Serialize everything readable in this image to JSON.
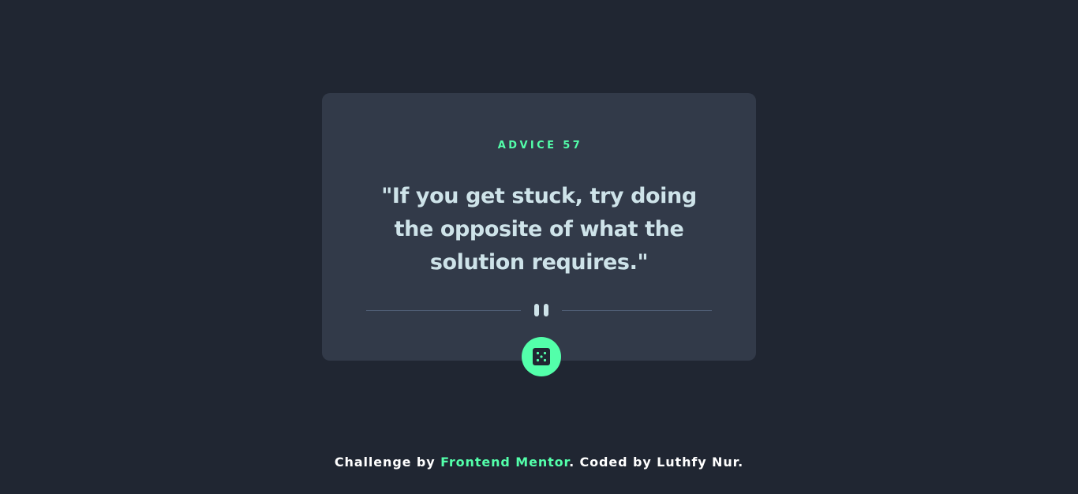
{
  "advice": {
    "label": "ADVICE 57",
    "text": "\"If you get stuck, try doing the opposite of what the solution requires.\""
  },
  "divider": {
    "icon": "pause-icon"
  },
  "dice_button": {
    "icon": "dice-icon"
  },
  "footer": {
    "prefix": "Challenge by ",
    "link_text": "Frontend Mentor",
    "suffix": ". Coded by Luthfy Nur."
  },
  "colors": {
    "background": "#202632",
    "card": "#323a49",
    "accent": "#53ffaa",
    "text": "#cee3e9",
    "divider": "#4f5d74"
  }
}
